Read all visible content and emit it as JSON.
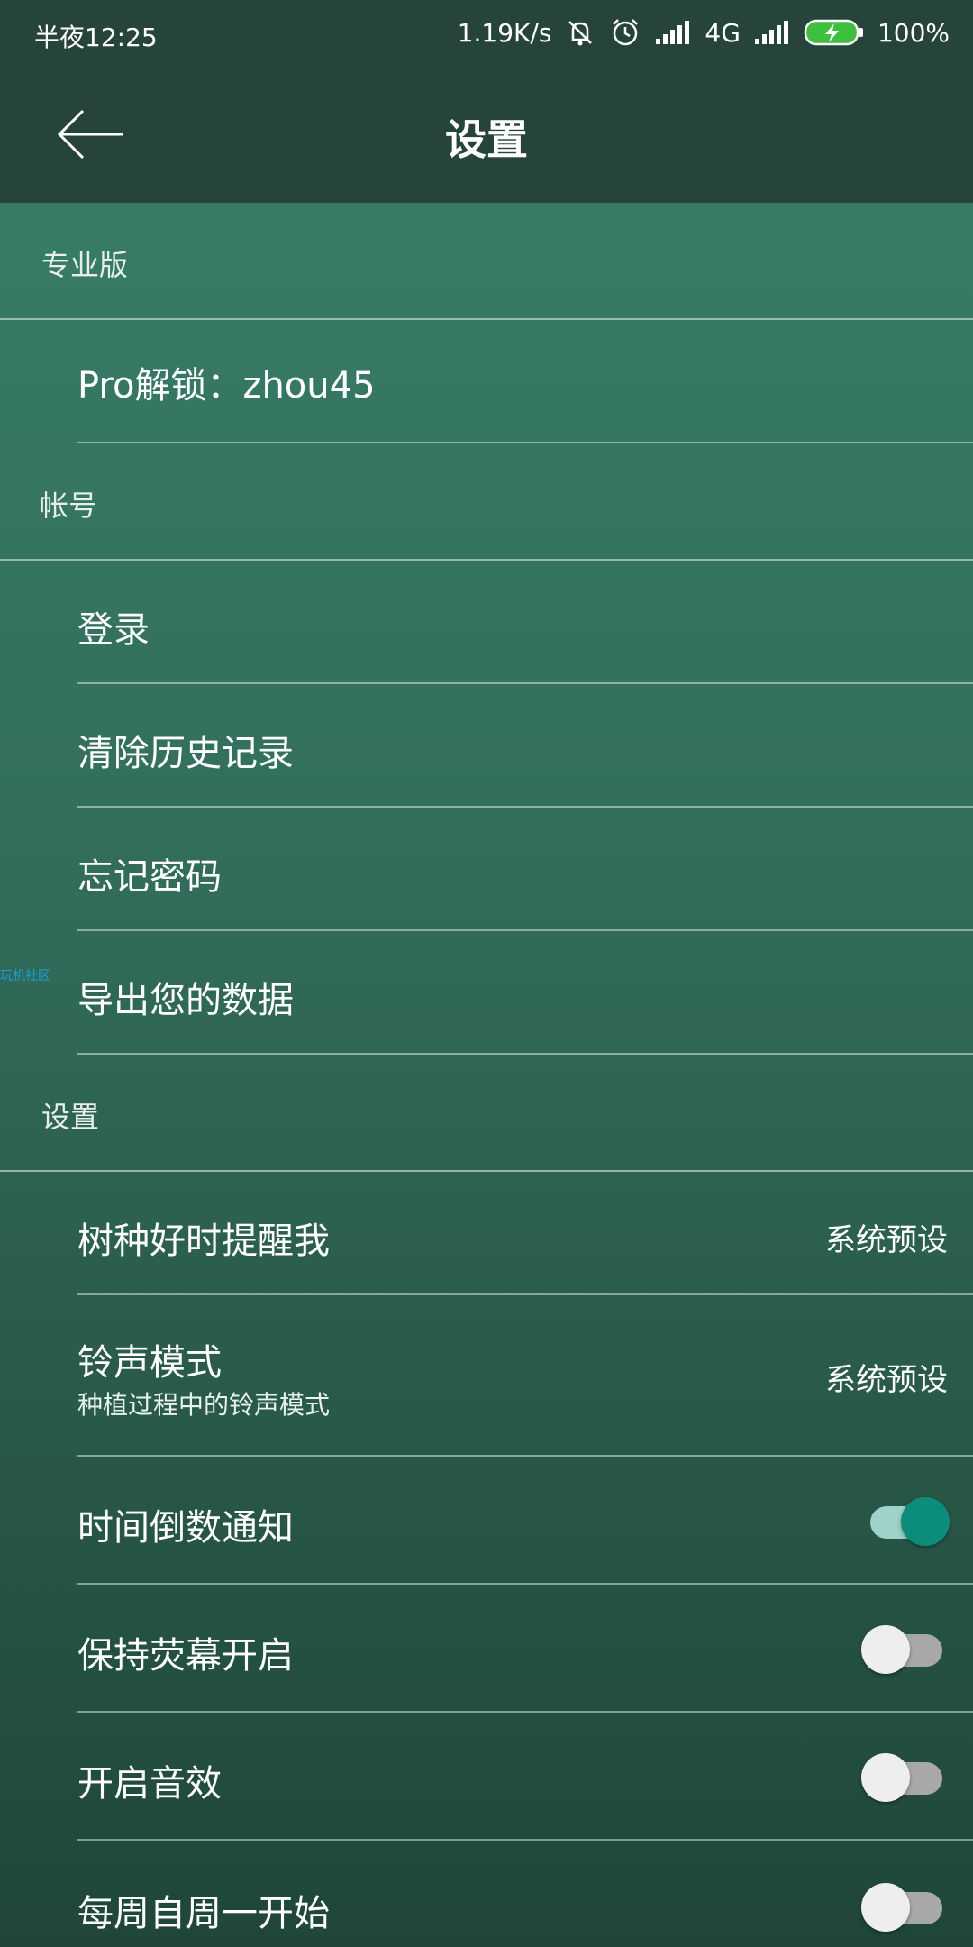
{
  "status_bar": {
    "time": "半夜12:25",
    "network_speed": "1.19K/s",
    "network_type": "4G",
    "battery": "100%",
    "icons": [
      "mute-icon",
      "alarm-icon",
      "signal-icon",
      "signal-icon",
      "battery-charging-icon"
    ]
  },
  "app_bar": {
    "title": "设置",
    "back_icon": "arrow-left-icon"
  },
  "sections": {
    "pro": {
      "header": "专业版",
      "unlock_label": "Pro解锁：zhou45"
    },
    "account": {
      "header": "帐号",
      "items": [
        "登录",
        "清除历史记录",
        "忘记密码",
        "导出您的数据"
      ]
    },
    "settings": {
      "header": "设置",
      "reminder": {
        "title": "树种好时提醒我",
        "value": "系统预设"
      },
      "ringtone": {
        "title": "铃声模式",
        "subtitle": "种植过程中的铃声模式",
        "value": "系统预设"
      },
      "countdown": {
        "title": "时间倒数通知",
        "enabled": true
      },
      "keep_screen": {
        "title": "保持荧幕开启",
        "enabled": false
      },
      "sound": {
        "title": "开启音效",
        "enabled": false
      },
      "week_start": {
        "title": "每周自周一开始",
        "enabled": false
      }
    }
  },
  "watermark": "玩机社区",
  "colors": {
    "app_bar": "#27443b",
    "toggle_on": "#0c8d7b",
    "toggle_on_track": "#9fd2c8",
    "toggle_off_track": "#a8a8a8"
  }
}
